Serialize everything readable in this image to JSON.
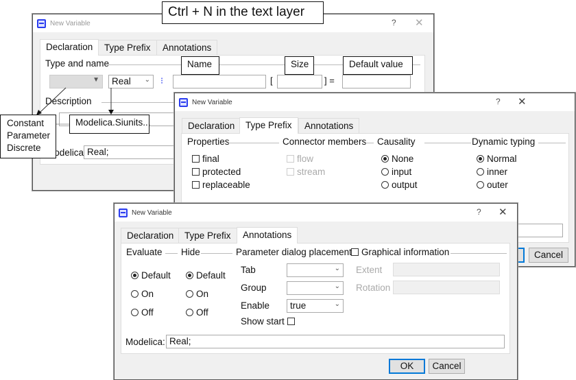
{
  "callouts": {
    "title": "Ctrl + N in the text layer",
    "name": "Name",
    "size": "Size",
    "default_value": "Default value",
    "prefix_options": [
      "Constant",
      "Parameter",
      "Discrete"
    ],
    "type_hint": "Modelica.Siunits..."
  },
  "dialog_title": "New Variable",
  "help": "?",
  "close": "✕",
  "tabs": [
    "Declaration",
    "Type Prefix",
    "Annotations"
  ],
  "declaration": {
    "type_and_name": "Type and name",
    "type_value": "Real",
    "bracket_open": "[",
    "bracket_close": "] =",
    "description": "Description",
    "modelica_label": "Modelica:",
    "modelica_value": "Real;"
  },
  "type_prefix": {
    "properties": {
      "label": "Properties",
      "items": [
        "final",
        "protected",
        "replaceable"
      ]
    },
    "connector": {
      "label": "Connector members",
      "items": [
        "flow",
        "stream"
      ]
    },
    "causality": {
      "label": "Causality",
      "items": [
        "None",
        "input",
        "output"
      ],
      "selected": "None"
    },
    "dynamic": {
      "label": "Dynamic typing",
      "items": [
        "Normal",
        "inner",
        "outer"
      ],
      "selected": "Normal"
    }
  },
  "annotations": {
    "evaluate": {
      "label": "Evaluate",
      "items": [
        "Default",
        "On",
        "Off"
      ],
      "selected": "Default"
    },
    "hide": {
      "label": "Hide",
      "items": [
        "Default",
        "On",
        "Off"
      ],
      "selected": "Default"
    },
    "placement": {
      "label": "Parameter dialog placement",
      "tab": "Tab",
      "group": "Group",
      "enable": "Enable",
      "enable_value": "true",
      "show_start": "Show start"
    },
    "graphical": {
      "label": "Graphical information",
      "extent": "Extent",
      "rotation": "Rotation"
    },
    "modelica_label": "Modelica:",
    "modelica_value": "Real;"
  },
  "buttons": {
    "ok": "OK",
    "cancel": "Cancel"
  }
}
